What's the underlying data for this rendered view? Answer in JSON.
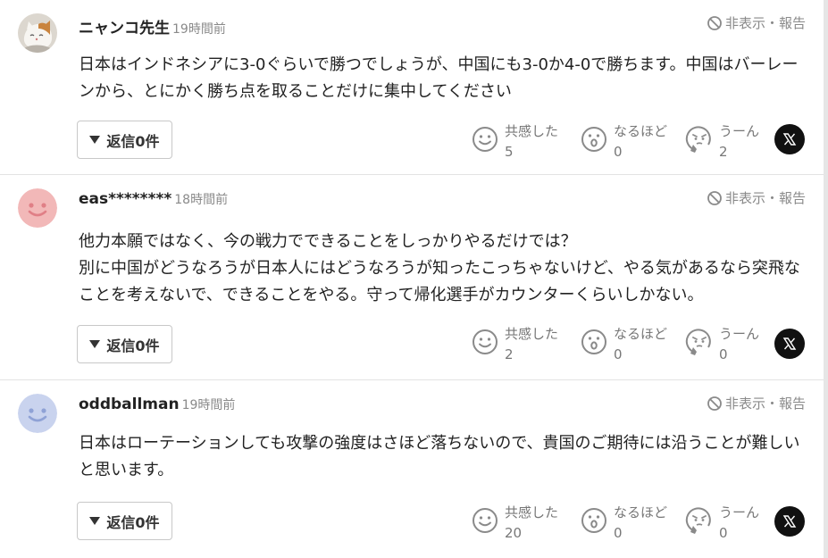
{
  "ui": {
    "hide_report_label": "非表示・報告",
    "reply_label": "返信0件",
    "reaction_labels": {
      "empathy": "共感した",
      "naruhodo": "なるほど",
      "uun": "うーん"
    }
  },
  "comments": [
    {
      "author": "ニャンコ先生",
      "time": "19時間前",
      "text": "日本はインドネシアに3-0ぐらいで勝つでしょうが、中国にも3-0か4-0で勝ちます。中国はバーレーンから、とにかく勝ち点を取ることだけに集中してください",
      "counts": {
        "empathy": "5",
        "naruhodo": "0",
        "uun": "2"
      },
      "avatar": "cat-photo"
    },
    {
      "author": "eas********",
      "time": "18時間前",
      "text": "他力本願ではなく、今の戦力でできることをしっかりやるだけでは？\n別に中国がどうなろうが日本人にはどうなろうが知ったこっちゃないけど、やる気があるなら突飛なことを考えないで、できることをやる。守って帰化選手がカウンターくらいしかない。",
      "counts": {
        "empathy": "2",
        "naruhodo": "0",
        "uun": "0"
      },
      "avatar": "pink-smiley"
    },
    {
      "author": "oddballman",
      "time": "19時間前",
      "text": "日本はローテーションしても攻撃の強度はさほど落ちないので、貴国のご期待には沿うことが難しいと思います。",
      "counts": {
        "empathy": "20",
        "naruhodo": "0",
        "uun": "0"
      },
      "avatar": "blue-smiley"
    }
  ],
  "colors": {
    "avatar_pink": "#f2b8b8",
    "avatar_pink_face": "#e07f86",
    "avatar_blue": "#c9d3ee",
    "avatar_blue_face": "#8fa2d6",
    "muted_text": "#8a8a8a",
    "icon_gray": "#8a8a8a"
  }
}
